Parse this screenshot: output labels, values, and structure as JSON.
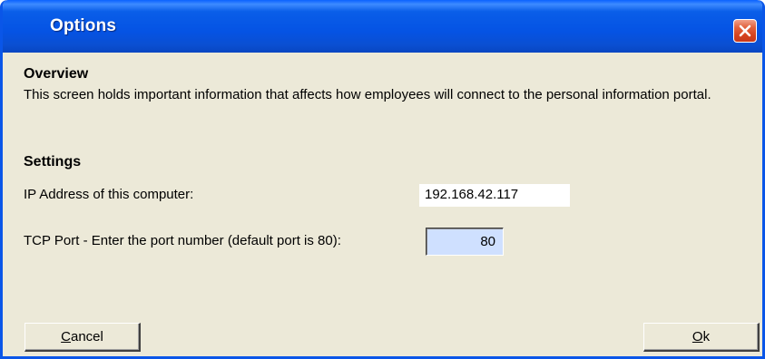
{
  "window": {
    "title": "Options"
  },
  "overview": {
    "heading": "Overview",
    "description": "This screen holds important information that affects how employees will connect to the personal information portal."
  },
  "settings": {
    "heading": "Settings",
    "ip_label": "IP Address of this computer:",
    "ip_value": "192.168.42.117",
    "port_label": "TCP Port - Enter the port number (default port is 80):",
    "port_value": "80"
  },
  "buttons": {
    "cancel": {
      "mnemonic": "C",
      "rest": "ancel"
    },
    "ok": {
      "mnemonic": "O",
      "rest": "k"
    }
  },
  "icons": {
    "close": "close-icon"
  },
  "colors": {
    "titlebar": "#0553e4",
    "close_button": "#d5431e",
    "dialog_bg": "#ece9d8",
    "port_input_bg": "#cfe0ff"
  }
}
